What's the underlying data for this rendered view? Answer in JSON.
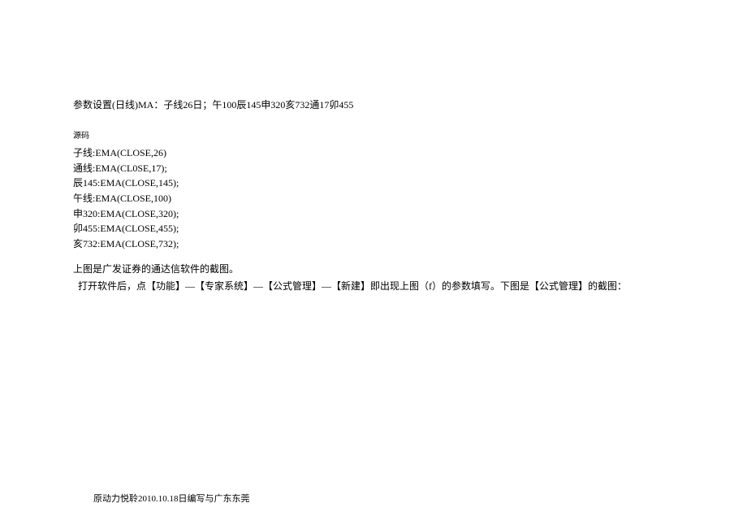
{
  "params_line": "参数设置(日线)MA：子线26日；午100辰145申320亥732通17卯455",
  "source_label": "源码",
  "code_lines": [
    "子线:EMA(CLOSE,26)",
    "通线:EMA(CL0SE,17);",
    "辰145:EMA(CLOSE,145);",
    "午线:EMA(CLOSE,100)",
    "申320:EMA(CLOSE,320);",
    "卯455:EMA(CLOSE,455);",
    "亥732:EMA(CLOSE,732);"
  ],
  "caption1": "上图是广发证券的通达信软件的截图。",
  "caption2": "打开软件后，点【功能】—【专家系统】—【公式管理】—【新建】即出现上图（f）的参数填写。下图是【公式管理】的截图：",
  "footer": "原动力悦聆2010.10.18日编写与广东东莞"
}
